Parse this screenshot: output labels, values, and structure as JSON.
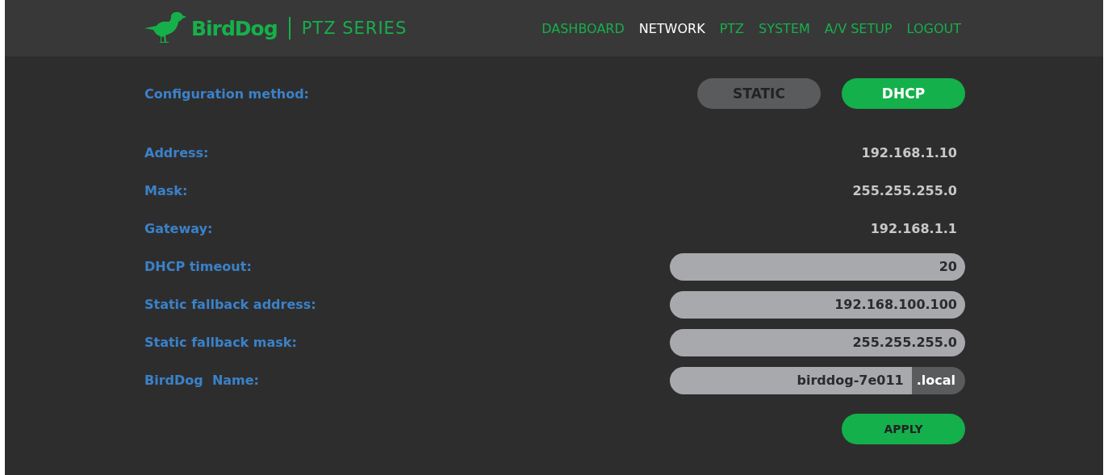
{
  "header": {
    "brand": "BirdDog",
    "series": "PTZ SERIES",
    "nav": [
      {
        "label": "DASHBOARD",
        "selected": false
      },
      {
        "label": "NETWORK",
        "selected": true
      },
      {
        "label": "PTZ",
        "selected": false
      },
      {
        "label": "SYSTEM",
        "selected": false
      },
      {
        "label": "A/V SETUP",
        "selected": false
      },
      {
        "label": "LOGOUT",
        "selected": false
      }
    ]
  },
  "config_method": {
    "label": "Configuration method:",
    "options": [
      {
        "label": "STATIC",
        "selected": false
      },
      {
        "label": "DHCP",
        "selected": true
      }
    ]
  },
  "fields": [
    {
      "kind": "text",
      "label": "Address:",
      "value": "192.168.1.10"
    },
    {
      "kind": "text",
      "label": "Mask:",
      "value": "255.255.255.0"
    },
    {
      "kind": "text",
      "label": "Gateway:",
      "value": "192.168.1.1"
    },
    {
      "kind": "input",
      "label": "DHCP timeout:",
      "value": "20"
    },
    {
      "kind": "input",
      "label": "Static fallback address:",
      "value": "192.168.100.100"
    },
    {
      "kind": "input",
      "label": "Static fallback mask:",
      "value": "255.255.255.0"
    },
    {
      "kind": "suffix",
      "label": "BirdDog  Name:",
      "value": "birddog-7e011",
      "suffix": ".local"
    }
  ],
  "apply": "APPLY"
}
